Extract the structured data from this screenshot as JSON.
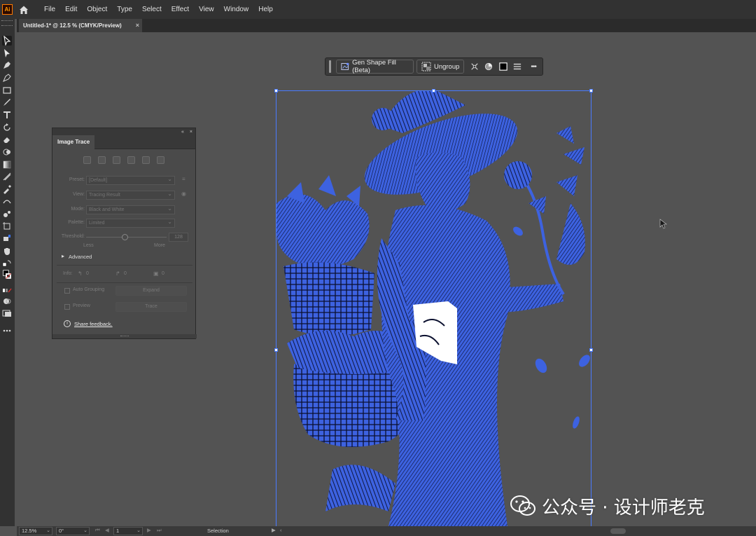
{
  "app": {
    "logo_text": "Ai",
    "menu": [
      "File",
      "Edit",
      "Object",
      "Type",
      "Select",
      "Effect",
      "View",
      "Window",
      "Help"
    ]
  },
  "document_tab": {
    "title": "Untitled-1* @ 12.5 % (CMYK/Preview)",
    "close": "×"
  },
  "context_bar": {
    "gen_shape_fill": "Gen Shape Fill (Beta)",
    "ungroup": "Ungroup",
    "more": "•••"
  },
  "image_trace": {
    "panel_controls": [
      "«",
      "×"
    ],
    "tab": "Image Trace",
    "preset_label": "Preset:",
    "preset_value": "[Default]",
    "view_label": "View:",
    "view_value": "Tracing Result",
    "mode_label": "Mode:",
    "mode_value": "Black and White",
    "palette_label": "Palette:",
    "palette_value": "Limited",
    "threshold_label": "Threshold:",
    "threshold_value": "128",
    "less": "Less",
    "more": "More",
    "advanced": "Advanced",
    "info_label": "Info:",
    "info_paths": "0",
    "info_anchors": "0",
    "info_colors": "0",
    "auto_grouping": "Auto Grouping",
    "expand": "Expand",
    "preview": "Preview",
    "trace": "Trace",
    "share_feedback": "Share feedback."
  },
  "status_bar": {
    "zoom": "12.5%",
    "rotate": "0°",
    "artboard": "1",
    "tool": "Selection"
  },
  "watermark": {
    "text": "公众号 · 设计师老克"
  },
  "colors": {
    "art_blue": "#3d62e0",
    "selection_blue": "#4a7bff",
    "ui_dark": "#323232",
    "canvas_gray": "#535353"
  }
}
